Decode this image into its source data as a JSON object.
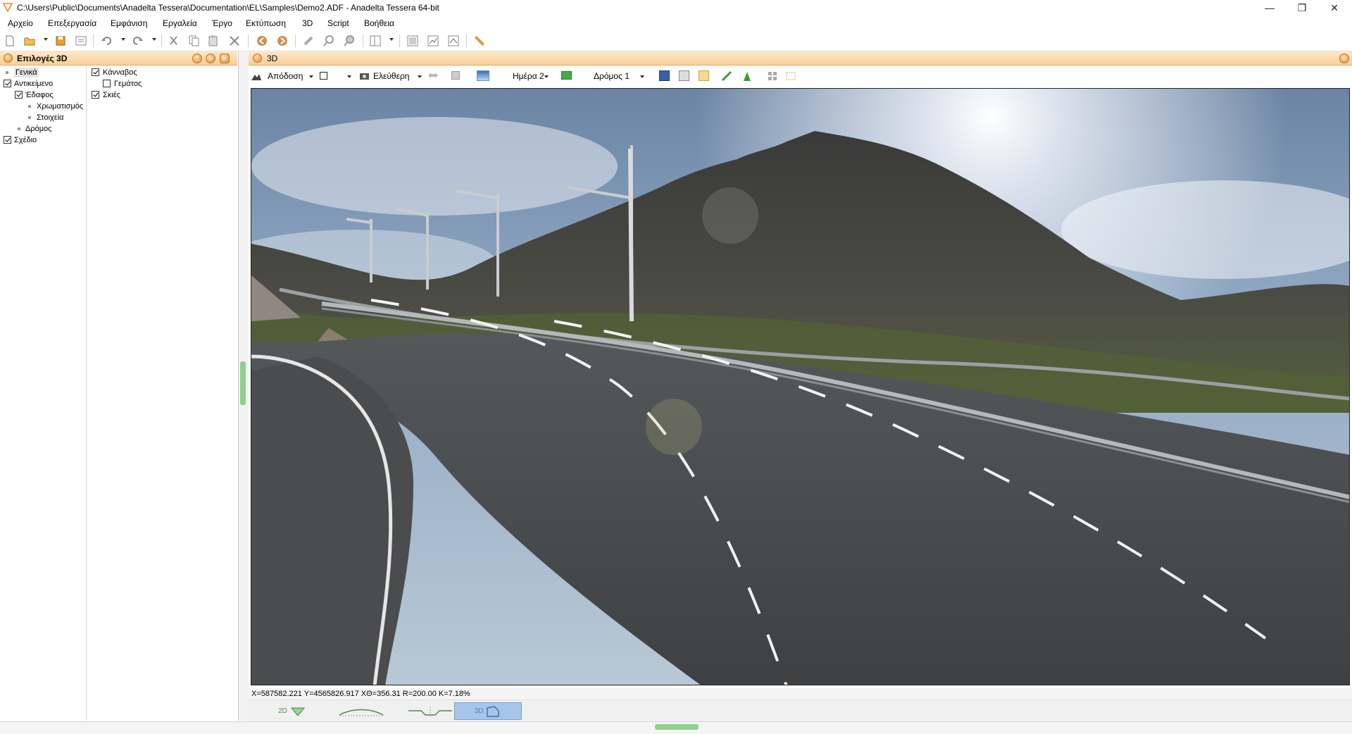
{
  "window": {
    "title": "C:\\Users\\Public\\Documents\\Anadelta Tessera\\Documentation\\EL\\Samples\\Demo2.ADF - Anadelta Tessera 64-bit",
    "minimize": "—",
    "maximize": "❐",
    "close": "✕"
  },
  "menu": [
    "Αρχείο",
    "Επεξεργασία",
    "Εμφάνιση",
    "Εργαλεία",
    "Έργο",
    "Εκτύπωση",
    "3D",
    "Script",
    "Βοήθεια"
  ],
  "left_panel": {
    "title": "Επιλογές 3D",
    "tree": [
      {
        "label": "Γενικά",
        "type": "bullet",
        "level": 0,
        "selected": true
      },
      {
        "label": "Αντικείμενο",
        "type": "checkbox",
        "checked": true,
        "level": 0
      },
      {
        "label": "Έδαφος",
        "type": "checkbox",
        "checked": true,
        "level": 1
      },
      {
        "label": "Χρωματισμός",
        "type": "bullet",
        "level": 2
      },
      {
        "label": "Στοιχεία",
        "type": "bullet",
        "level": 2
      },
      {
        "label": "Δρόμος",
        "type": "bullet",
        "level": 1
      },
      {
        "label": "Σχέδιο",
        "type": "checkbox",
        "checked": true,
        "level": 0
      }
    ],
    "options": [
      {
        "label": "Κάνναβος",
        "checked": true,
        "level": 0
      },
      {
        "label": "Γεμάτος",
        "checked": false,
        "level": 1
      },
      {
        "label": "Σκιές",
        "checked": true,
        "level": 0
      }
    ]
  },
  "right_panel": {
    "title": "3D",
    "toolbar": {
      "render_label": "Απόδοση",
      "camera_label": "Ελεύθερη",
      "day_label": "Ημέρα 2",
      "road_label": "Δρόμος 1"
    }
  },
  "status": {
    "coords": "X=587582.221  Y=4565826.917  ΧΘ=356.31 R=200.00 K=7.18%"
  },
  "view_tabs": [
    {
      "label": "2D",
      "active": false
    },
    {
      "label": "",
      "active": false
    },
    {
      "label": "",
      "active": false
    },
    {
      "label": "3D",
      "active": true
    }
  ],
  "colors": {
    "panel_header": "#f9cf95",
    "accent_orange": "#e28a2e",
    "active_tab": "#a9c4ea",
    "splitter_grip": "#8ed08e"
  }
}
